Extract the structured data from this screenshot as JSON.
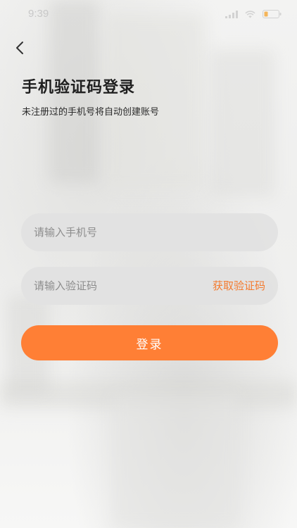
{
  "status_bar": {
    "time": "9:39"
  },
  "header": {
    "back_icon": "chevron-left-icon"
  },
  "page": {
    "title": "手机验证码登录",
    "subtitle": "未注册过的手机号将自动创建账号"
  },
  "form": {
    "phone_placeholder": "请输入手机号",
    "phone_value": "",
    "code_placeholder": "请输入验证码",
    "code_value": "",
    "get_code_label": "获取验证码",
    "login_label": "登录"
  },
  "colors": {
    "accent": "#ff7f35",
    "link": "#f47b2f"
  }
}
